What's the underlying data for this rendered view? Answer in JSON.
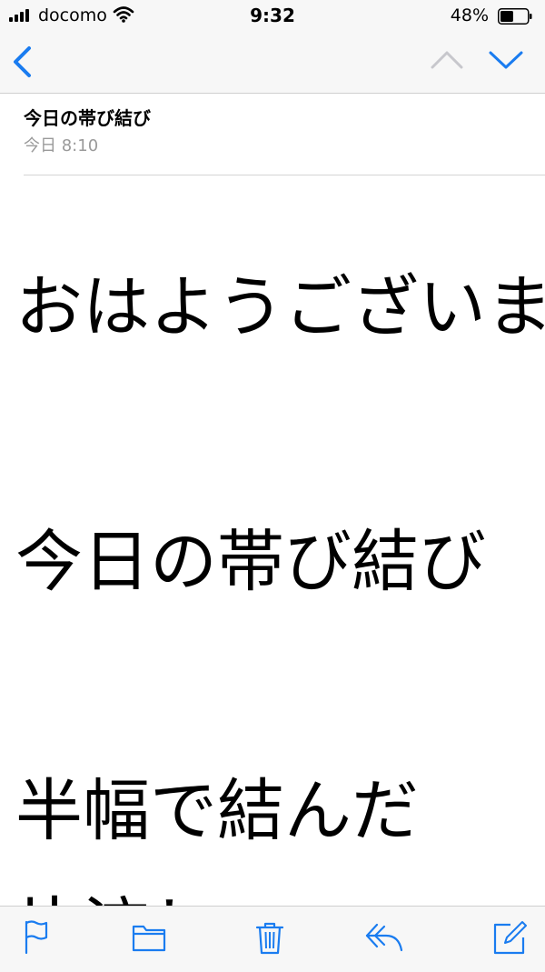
{
  "status_bar": {
    "carrier": "docomo",
    "time": "9:32",
    "battery_percent": "48%",
    "battery_level": 0.48
  },
  "nav": {
    "back_icon": "chevron-left-icon",
    "prev_icon": "chevron-up-icon",
    "next_icon": "chevron-down-icon"
  },
  "email": {
    "subject": "今日の帯び結び",
    "date": "今日 8:10",
    "body_lines": [
      "おはようございます",
      "今日の帯び結び",
      "半幅で結んだ",
      "片流し"
    ]
  },
  "toolbar": {
    "icons": [
      "flag-icon",
      "folder-icon",
      "trash-icon",
      "reply-icon",
      "compose-icon"
    ]
  },
  "colors": {
    "accent": "#1a7cf0",
    "disabled": "#c7c7cc",
    "bar_bg": "#f7f7f7"
  }
}
